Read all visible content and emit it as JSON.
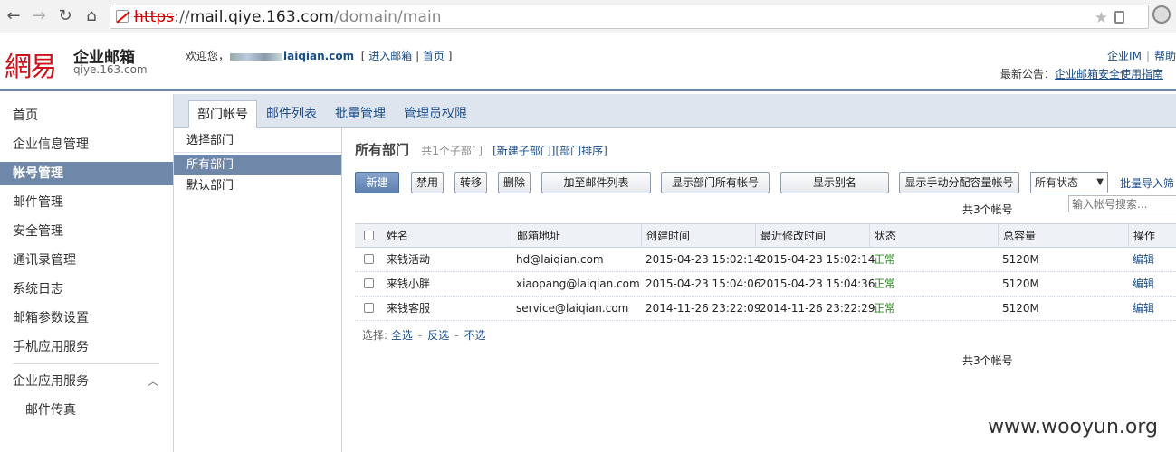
{
  "browser": {
    "url_scheme": "https",
    "url_host": "mail.qiye.163.com",
    "url_path": "/domain/main"
  },
  "header": {
    "logo_text": "網易",
    "product_title": "企业邮箱",
    "product_domain": "qiye.163.com",
    "welcome_prefix": "欢迎您，",
    "user_domain": "laiqian.com",
    "enter_mailbox": "进入邮箱",
    "home_link": "首页",
    "top_links": [
      "企业IM",
      "帮助"
    ],
    "notice_label": "最新公告：",
    "notice_link": "企业邮箱安全使用指南"
  },
  "sidebar": {
    "items": [
      {
        "label": "首页"
      },
      {
        "label": "企业信息管理"
      },
      {
        "label": "帐号管理"
      },
      {
        "label": "邮件管理"
      },
      {
        "label": "安全管理"
      },
      {
        "label": "通讯录管理"
      },
      {
        "label": "系统日志"
      },
      {
        "label": "邮箱参数设置"
      },
      {
        "label": "手机应用服务"
      },
      {
        "label": "企业应用服务"
      },
      {
        "label": "邮件传真"
      }
    ],
    "active_index": 2
  },
  "tabs": [
    {
      "label": "部门帐号"
    },
    {
      "label": "邮件列表"
    },
    {
      "label": "批量管理"
    },
    {
      "label": "管理员权限"
    }
  ],
  "dept_panel": {
    "header": "选择部门",
    "items": [
      {
        "label": "所有部门"
      },
      {
        "label": "默认部门"
      }
    ]
  },
  "main": {
    "title": "所有部门",
    "sub_count": "共1个子部门",
    "new_sub_link": "[新建子部门]",
    "sort_link": "[部门排序]",
    "toolbar": {
      "new": "新建",
      "disable": "禁用",
      "move": "转移",
      "delete": "删除",
      "add_to_list": "加至邮件列表",
      "show_all": "显示部门所有帐号",
      "show_alias": "显示别名",
      "show_manual": "显示手动分配容量帐号",
      "status_select": "所有状态",
      "batch_import": "批量导入筛"
    },
    "search_placeholder": "输入帐号搜索...",
    "total_label": "共3个帐号",
    "columns": [
      "姓名",
      "邮箱地址",
      "创建时间",
      "最近修改时间",
      "状态",
      "总容量",
      "操作"
    ],
    "rows": [
      {
        "name": "来钱活动",
        "email": "hd@laiqian.com",
        "created": "2015-04-23 15:02:14",
        "modified": "2015-04-23 15:02:14",
        "status": "正常",
        "capacity": "5120M",
        "op": "编辑"
      },
      {
        "name": "来钱小胖",
        "email": "xiaopang@laiqian.com",
        "created": "2015-04-23 15:04:06",
        "modified": "2015-04-23 15:04:36",
        "status": "正常",
        "capacity": "5120M",
        "op": "编辑"
      },
      {
        "name": "来钱客服",
        "email": "service@laiqian.com",
        "created": "2014-11-26 23:22:09",
        "modified": "2014-11-26 23:22:29",
        "status": "正常",
        "capacity": "5120M",
        "op": "编辑"
      }
    ],
    "select_bar": {
      "label": "选择:",
      "all": "全选",
      "invert": "反选",
      "none": "不选"
    }
  },
  "watermark": "www.wooyun.org"
}
